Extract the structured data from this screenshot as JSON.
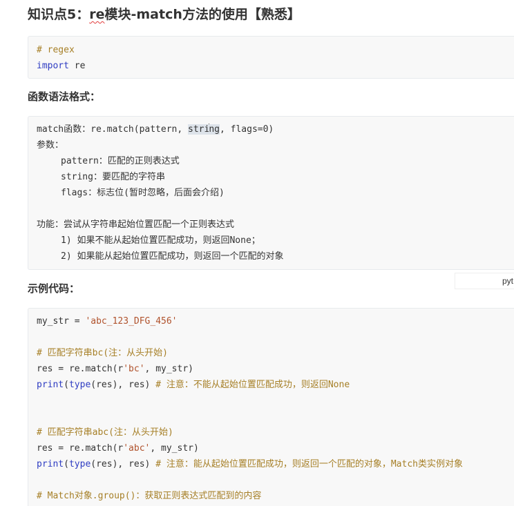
{
  "heading": {
    "prefix": "知识点5：",
    "underlined": "re",
    "suffix": "模块-match方法的使用【熟悉】"
  },
  "block1": {
    "comment": "# regex",
    "import_kw": "import",
    "import_rest": " re"
  },
  "section_syntax": "函数语法格式：",
  "block2": {
    "l1_a": "match函数：re.match(pattern, ",
    "l1_sel_a": "stri",
    "l1_sel_b": "ng",
    "l1_b": ", flags=0)",
    "l2": "参数：",
    "l3": "pattern：匹配的正则表达式",
    "l4": "string：要匹配的字符串",
    "l5": "flags：标志位(暂时忽略，后面会介绍)",
    "l6": "功能：尝试从字符串起始位置匹配一个正则表达式",
    "l7": "1) 如果不能从起始位置匹配成功，则返回None；",
    "l8": "2) 如果能从起始位置匹配成功，则返回一个匹配的对象"
  },
  "lang_label": "pyt",
  "section_example": "示例代码：",
  "block3": {
    "l1_a": "my_str = ",
    "l1_str": "'abc_123_DFG_456'",
    "l2": "# 匹配字符串bc(注：从头开始)",
    "l3_a": "res = re.match(r",
    "l3_str": "'bc'",
    "l3_b": ", my_str)",
    "l4_print": "print",
    "l4_paren": "(",
    "l4_type": "type",
    "l4_args": "(res), res) ",
    "l4_cmt": "# 注意：不能从起始位置匹配成功，则返回None",
    "l5": "# 匹配字符串abc(注：从头开始)",
    "l6_a": "res = re.match(r",
    "l6_str": "'abc'",
    "l6_b": ", my_str)",
    "l7_print": "print",
    "l7_paren": "(",
    "l7_type": "type",
    "l7_args": "(res), res) ",
    "l7_cmt": "# 注意：能从起始位置匹配成功，则返回一个匹配的对象，Match类实例对象",
    "l8": "# Match对象.group()：获取正则表达式匹配到的内容"
  }
}
